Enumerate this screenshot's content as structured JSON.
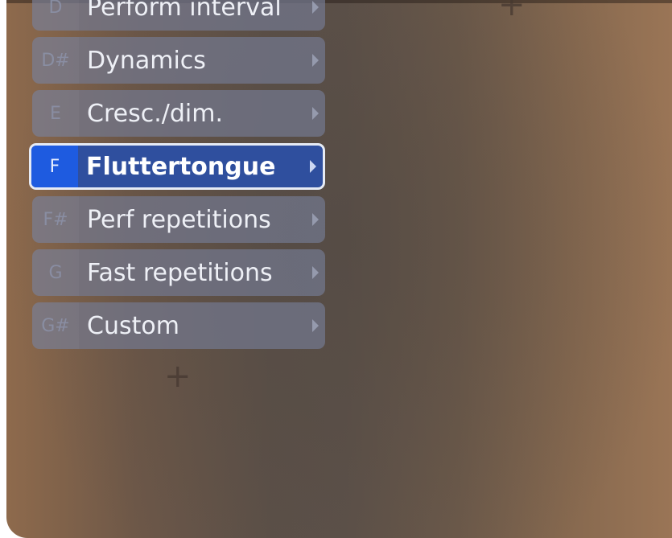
{
  "menu": {
    "items": [
      {
        "key": "D",
        "label": "Perform interval",
        "selected": false
      },
      {
        "key": "D#",
        "label": "Dynamics",
        "selected": false
      },
      {
        "key": "E",
        "label": "Cresc./dim.",
        "selected": false
      },
      {
        "key": "F",
        "label": "Fluttertongue",
        "selected": true
      },
      {
        "key": "F#",
        "label": "Perf repetitions",
        "selected": false
      },
      {
        "key": "G",
        "label": "Fast repetitions",
        "selected": false
      },
      {
        "key": "G#",
        "label": "Custom",
        "selected": false
      }
    ],
    "add_symbol": "+"
  },
  "workspace": {
    "add_symbol": "+"
  },
  "colors": {
    "selected_item_bg": "#2f4f9e",
    "selected_key_bg": "#1e5be0",
    "item_bg": "#747990"
  },
  "icons": {
    "submenu": "chevron-right-icon",
    "add": "plus-icon"
  }
}
